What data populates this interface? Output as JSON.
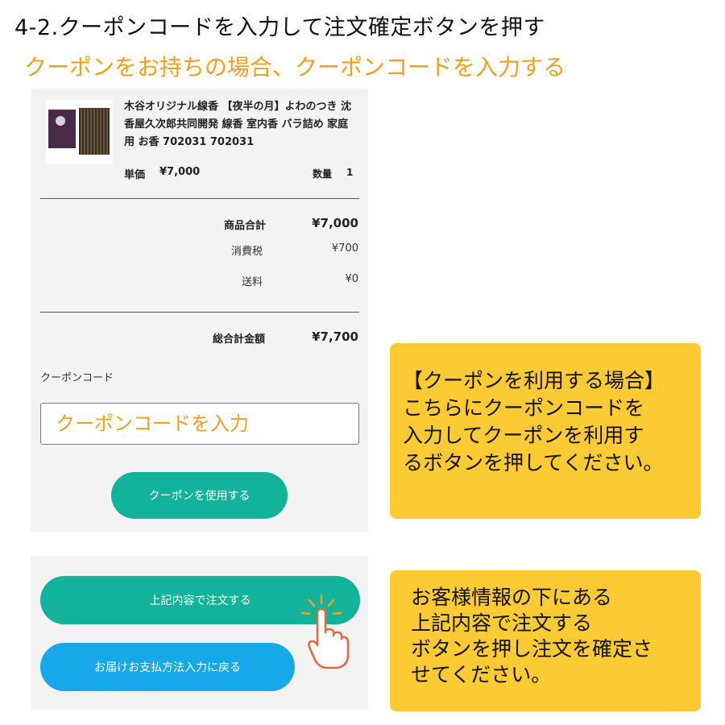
{
  "heading": "4-2.クーポンコードを入力して注文確定ボタンを押す",
  "subheading": "クーポンをお持ちの場合、クーポンコードを入力する",
  "product": {
    "image_icon": "incense-product-image",
    "name": "木谷オリジナル線香 【夜半の月】よわのつき 沈香屋久次郎共同開発 線香 室内香 バラ詰め 家庭用 お香 702031 702031",
    "unit_price_label": "単価",
    "unit_price": "¥7,000",
    "quantity_label": "数量",
    "quantity": "1"
  },
  "summary": {
    "subtotal_label": "商品合計",
    "subtotal": "¥7,000",
    "tax_label": "消費税",
    "tax": "¥700",
    "shipping_label": "送料",
    "shipping": "¥0",
    "total_label": "総合計金額",
    "total": "¥7,700"
  },
  "coupon": {
    "label": "クーポンコード",
    "placeholder": "クーポンコードを入力",
    "button": "クーポンを使用する"
  },
  "order": {
    "confirm_button": "上記内容で注文する",
    "back_button": "お届けお支払方法入力に戻る",
    "pointer_icon": "pointing-hand-icon"
  },
  "callouts": {
    "coupon_lines": [
      "【クーポンを利用する場合】",
      "こちらにクーポンコードを",
      "入力してクーポンを利用す",
      "るボタンを押してください。"
    ],
    "order_lines": [
      "お客様情報の下にある",
      "上記内容で注文する",
      "ボタンを押し注文を確定さ",
      "せてください。"
    ]
  },
  "colors": {
    "accent_orange": "#f0a01e",
    "button_teal": "#12b39a",
    "button_blue": "#16a8e8",
    "callout_yellow": "#fcca32",
    "panel_gray": "#f2f3f2"
  }
}
